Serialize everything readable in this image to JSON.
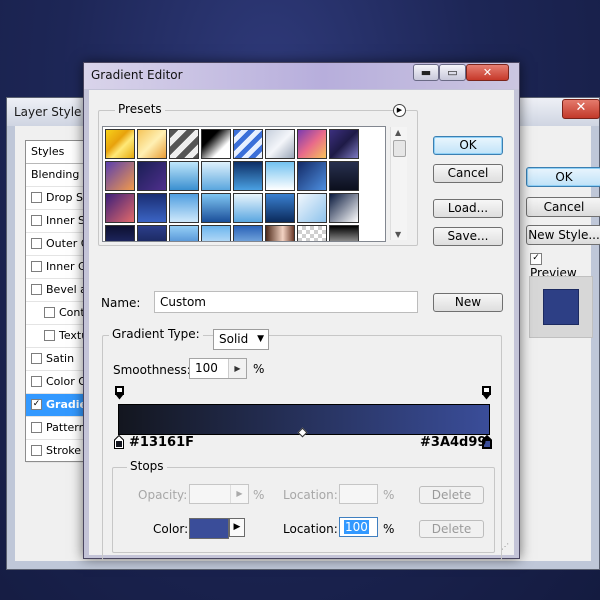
{
  "layer_style": {
    "title": "Layer Style",
    "close_label": "✕",
    "styles_header": "Styles",
    "items": [
      {
        "label": "Blending Options",
        "checkbox": false,
        "checked": false,
        "sub": false,
        "selected": false
      },
      {
        "label": "Drop Shadow",
        "checkbox": true,
        "checked": false,
        "sub": false,
        "selected": false
      },
      {
        "label": "Inner Shadow",
        "checkbox": true,
        "checked": false,
        "sub": false,
        "selected": false
      },
      {
        "label": "Outer Glow",
        "checkbox": true,
        "checked": false,
        "sub": false,
        "selected": false
      },
      {
        "label": "Inner Glow",
        "checkbox": true,
        "checked": false,
        "sub": false,
        "selected": false
      },
      {
        "label": "Bevel and Emboss",
        "checkbox": true,
        "checked": false,
        "sub": false,
        "selected": false
      },
      {
        "label": "Contour",
        "checkbox": true,
        "checked": false,
        "sub": true,
        "selected": false
      },
      {
        "label": "Texture",
        "checkbox": true,
        "checked": false,
        "sub": true,
        "selected": false
      },
      {
        "label": "Satin",
        "checkbox": true,
        "checked": false,
        "sub": false,
        "selected": false
      },
      {
        "label": "Color Overlay",
        "checkbox": true,
        "checked": false,
        "sub": false,
        "selected": false
      },
      {
        "label": "Gradient Overlay",
        "checkbox": true,
        "checked": true,
        "sub": false,
        "selected": true
      },
      {
        "label": "Pattern Overlay",
        "checkbox": true,
        "checked": false,
        "sub": false,
        "selected": false
      },
      {
        "label": "Stroke",
        "checkbox": true,
        "checked": false,
        "sub": false,
        "selected": false
      }
    ],
    "ok_label": "OK",
    "cancel_label": "Cancel",
    "new_style_label": "New Style...",
    "preview_label": "Preview",
    "preview_checked": true,
    "preview_color": "#2d3f85"
  },
  "gradient_editor": {
    "title": "Gradient Editor",
    "window_controls": {
      "minimize": "▬",
      "maximize": "▭",
      "close": "✕"
    },
    "presets_label": "Presets",
    "presets_menu_icon": "play-circle-icon",
    "preset_swatches": [
      "linear-gradient(135deg,#f7d21b,#e8a20c 40%,#ffe978 60%,#e5a90d)",
      "linear-gradient(135deg,#f5c55a,#fff0b3 50%,#e89c35)",
      "repeating-linear-gradient(135deg,#555 0 6px,#eee 6px 12px)",
      "linear-gradient(135deg,#000 30%,#fff 70%)",
      "repeating-linear-gradient(135deg,#3b6fd9 0 5px,#e7efff 5px 10px)",
      "linear-gradient(135deg,#c6cfdc,#f4f6fa 50%,#9aa6b8)",
      "linear-gradient(135deg,#7a3bb0,#e86a8a 50%,#f7c35a)",
      "linear-gradient(135deg,#3b2f7e,#1e1a46 50%,#7d79c2)",
      "linear-gradient(135deg,#5a3fae,#f29a4b)",
      "linear-gradient(135deg,#1a1f55,#4f2f8d)",
      "linear-gradient(180deg,#bfe6fb,#3a8fd0)",
      "linear-gradient(180deg,#dff1fc,#5aa6de)",
      "linear-gradient(180deg,#0e2f66,#4aa0e2)",
      "linear-gradient(180deg,#72c2f0,#ffffff)",
      "linear-gradient(135deg,#142a66,#4d8fe0)",
      "linear-gradient(180deg,#28304f,#0c0f1d)",
      "linear-gradient(135deg,#3b1f7a,#e36a6a)",
      "linear-gradient(180deg,#1a2e73,#3b64c4)",
      "linear-gradient(180deg,#4f9ee0,#cfe9fb)",
      "linear-gradient(180deg,#7fc6f2,#1b4f9a)",
      "linear-gradient(180deg,#e9f5fd,#5aa6e0)",
      "linear-gradient(180deg,#3a80d0,#0b2a5c)",
      "linear-gradient(135deg,#f2f7fd,#8ec3ec)",
      "linear-gradient(135deg,#0a1a3e,#ffffff)",
      "linear-gradient(180deg,#0d1030,#2a3580)",
      "linear-gradient(180deg,#2c3e8a,#0f1a44)",
      "linear-gradient(180deg,#95cff6,#2a6cc0)",
      "linear-gradient(180deg,#6cb5ee,#e8f4fd)",
      "linear-gradient(180deg,#2a62b8,#a9d6f6)",
      "linear-gradient(90deg,#4e2a1a,#f2d2c2 60%,#6b3a2a)",
      "repeating-conic-gradient(#cfcfcf 0 25%,#ffffff 0 50%) 0 0/8px 8px",
      "linear-gradient(180deg,#000000,#ffffff)",
      "linear-gradient(90deg,#c0102a,#ff3a3a)",
      "linear-gradient(90deg,#1f1f6a,#c81c2a)",
      "linear-gradient(90deg,#e81c1c,#ffd200,#1bb51b)",
      "linear-gradient(90deg,#1b5fe8,#ffd200)",
      "linear-gradient(90deg,#ff2d9a,#ffe100)",
      "linear-gradient(90deg,#ffae00,#ff3b00)",
      "linear-gradient(90deg,#2a7d2a,#d4241f,#f5c400)",
      "linear-gradient(90deg,#5c1fb0,#1fb0d9)"
    ],
    "ok_label": "OK",
    "cancel_label": "Cancel",
    "load_label": "Load...",
    "save_label": "Save...",
    "name_label": "Name:",
    "name_value": "Custom",
    "new_label": "New",
    "gradient_type_label": "Gradient Type:",
    "gradient_type_value": "Solid",
    "smoothness_label": "Smoothness:",
    "smoothness_value": "100",
    "smoothness_unit": "%",
    "gradient": {
      "start_color": "#13161F",
      "end_color": "#3A4d99",
      "midpoint": 0.5
    },
    "stop_left_hex": "#13161F",
    "stop_right_hex": "#3A4d99",
    "stops": {
      "label": "Stops",
      "opacity_label": "Opacity:",
      "opacity_value": "",
      "opacity_unit": "%",
      "opacity_location_label": "Location:",
      "opacity_location_value": "",
      "opacity_location_unit": "%",
      "delete_label": "Delete",
      "color_label": "Color:",
      "color_value": "#3A4d99",
      "color_location_label": "Location:",
      "color_location_value": "100",
      "color_location_unit": "%",
      "color_delete_label": "Delete"
    }
  }
}
